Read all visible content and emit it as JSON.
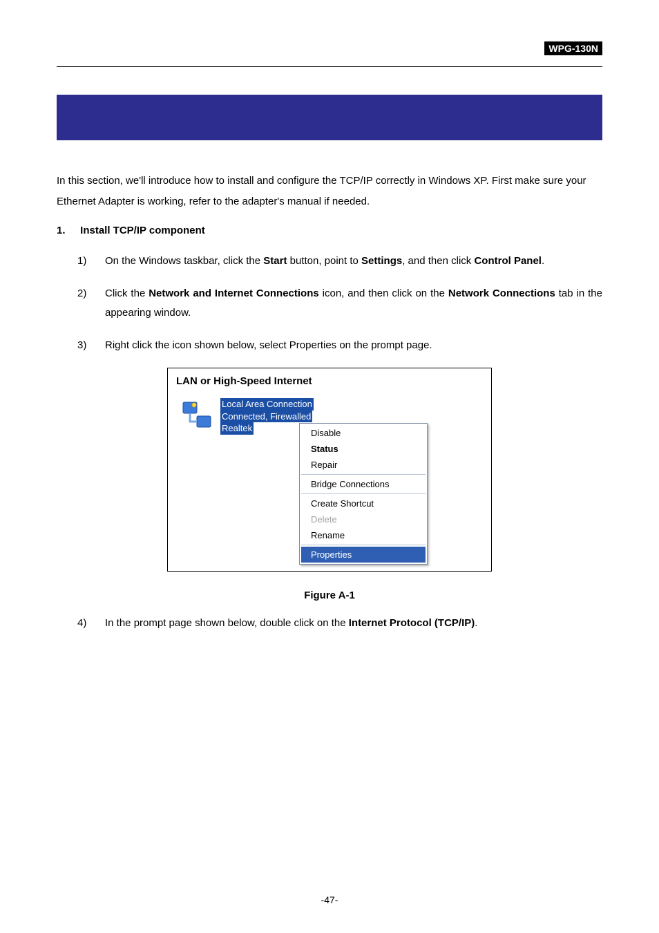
{
  "header": {
    "tag": "WPG-130N"
  },
  "intro": "In this section, we'll introduce how to install and configure the TCP/IP correctly in Windows XP. First make sure your Ethernet Adapter is working, refer to the adapter's manual if needed.",
  "section": {
    "number": "1.",
    "title": "Install TCP/IP component"
  },
  "steps": {
    "s1": {
      "num": "1)",
      "pre": "On the Windows taskbar, click the ",
      "b1": "Start",
      "mid1": " button, point to ",
      "b2": "Settings",
      "mid2": ", and then click ",
      "b3": "Control Panel",
      "post": "."
    },
    "s2": {
      "num": "2)",
      "pre": "Click the ",
      "b1": "Network and Internet Connections",
      "mid1": " icon, and then click on the ",
      "b2": "Network Connections",
      "post": " tab in the appearing window."
    },
    "s3": {
      "num": "3)",
      "text": "Right click the icon shown below, select Properties on the prompt page."
    },
    "s4": {
      "num": "4)",
      "pre": "In the prompt page shown below, double click on the ",
      "b1": "Internet Protocol (TCP/IP)",
      "post": "."
    }
  },
  "figure": {
    "title": "LAN or High-Speed Internet",
    "conn": {
      "line1": "Local Area Connection",
      "line2": "Connected, Firewalled",
      "line3": "Realtek"
    },
    "menu": {
      "disable": "Disable",
      "status": "Status",
      "repair": "Repair",
      "bridge": "Bridge Connections",
      "shortcut": "Create Shortcut",
      "delete": "Delete",
      "rename": "Rename",
      "properties": "Properties"
    },
    "caption": "Figure A-1"
  },
  "page_number": "-47-"
}
